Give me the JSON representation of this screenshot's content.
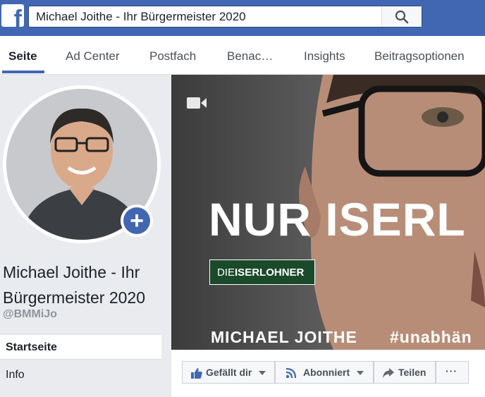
{
  "header": {
    "search_value": "Michael Joithe - Ihr Bürgermeister 2020",
    "logo_icon": "facebook-logo-icon",
    "search_icon": "search-icon"
  },
  "tabs": [
    {
      "label": "Seite",
      "active": true
    },
    {
      "label": "Ad Center"
    },
    {
      "label": "Postfach"
    },
    {
      "label": "Benac…"
    },
    {
      "label": "Insights"
    },
    {
      "label": "Beitragsoptionen"
    }
  ],
  "profile": {
    "name": "Michael Joithe - Ihr Bürgermeister 2020",
    "handle": "@BMMiJo"
  },
  "sidebar": {
    "items": [
      {
        "label": "Startseite",
        "active": true
      },
      {
        "label": "Info"
      }
    ]
  },
  "cover": {
    "headline": "NUR ISERL",
    "logo_prefix": "DIE",
    "logo_main": "ISERLOHNER",
    "bottom_name": "MICHAEL JOITHE",
    "bottom_tag": "#unabhän",
    "video_icon": "video-camera-icon"
  },
  "actions": {
    "like": "Gefällt dir",
    "follow": "Abonniert",
    "share": "Teilen",
    "more": "···"
  },
  "colors": {
    "brand": "#4267b2"
  }
}
